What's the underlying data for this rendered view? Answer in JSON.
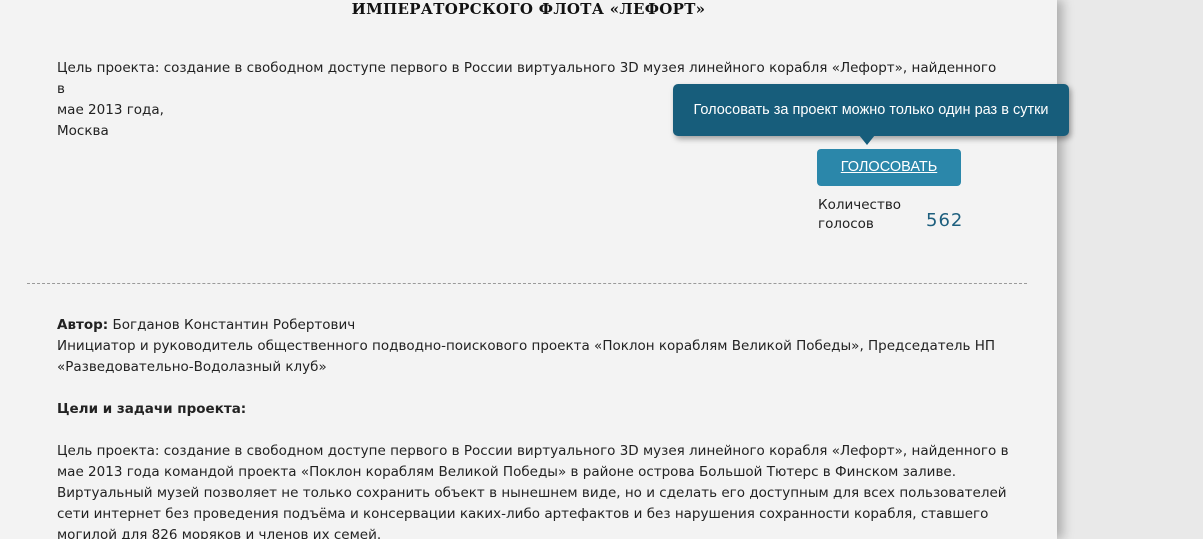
{
  "project": {
    "title": "ИМПЕРАТОРСКОГО ФЛОТА «ЛЕФОРТ»",
    "goal_line1": "Цель проекта: создание в свободном доступе первого в России виртуального 3D музея линейного корабля «Лефорт», найденного в",
    "goal_line2": "мае 2013 года,",
    "city": "Москва"
  },
  "vote": {
    "tooltip": "Голосовать за проект можно только один раз в сутки",
    "button_label": "ГОЛОСОВАТЬ",
    "count_label": "Количество голосов",
    "count": "562"
  },
  "author": {
    "label": "Автор:",
    "name": "Богданов Константин Робертович",
    "role_line1": "Инициатор и руководитель общественного подводно-поискового проекта «Поклон кораблям Великой Победы», Председатель НП",
    "role_line2": "«Разведовательно-Водолазный клуб»"
  },
  "goals": {
    "heading": "Цели и задачи проекта:",
    "lines": [
      "Цель проекта: создание в свободном доступе первого в России виртуального 3D музея линейного корабля «Лефорт», найденного в",
      "мае 2013 года командой проекта «Поклон кораблям Великой Победы» в районе острова Большой Тютерс в Финском заливе.",
      "Виртуальный музей позволяет не только сохранить объект в нынешнем виде, но и сделать его доступным для всех пользователей",
      "сети интернет без проведения подъёма и консервации каких-либо артефактов и без нарушения сохранности корабля, ставшего",
      "могилой для 826 моряков и членов их семей."
    ]
  },
  "colors": {
    "tooltip_bg": "#175d7b",
    "button_bg": "#2b87aa",
    "count_color": "#1d5f7e"
  }
}
